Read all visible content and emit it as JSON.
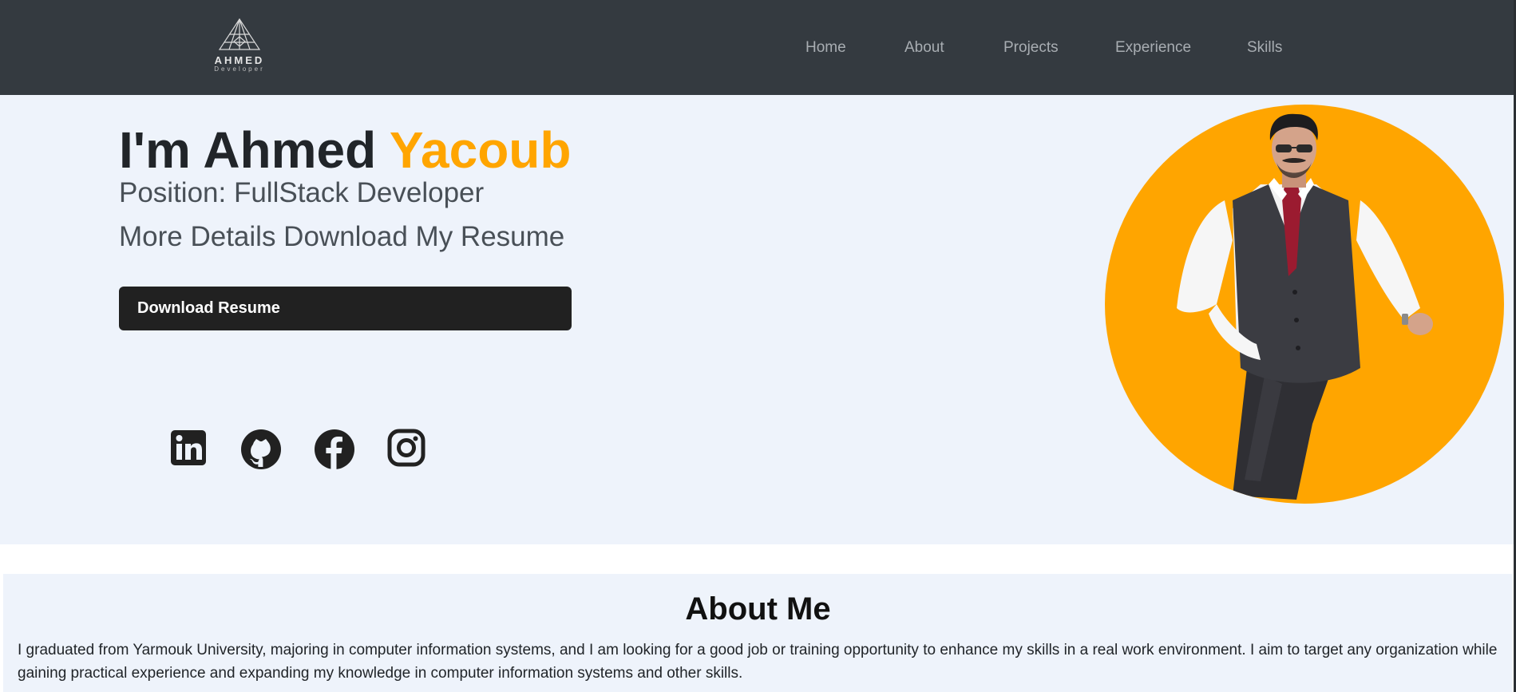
{
  "nav": {
    "brand_name": "AHMED",
    "brand_sub": "Developer",
    "items": [
      {
        "label": "Home"
      },
      {
        "label": "About"
      },
      {
        "label": "Projects"
      },
      {
        "label": "Experience"
      },
      {
        "label": "Skills"
      }
    ]
  },
  "hero": {
    "title_prefix": "I'm Ahmed ",
    "title_accent": "Yacoub",
    "position_line": "Position: FullStack Developer",
    "details_line": "More Details Download My Resume",
    "resume_button": "Download Resume",
    "socials": [
      {
        "icon": "linkedin-icon"
      },
      {
        "icon": "github-icon"
      },
      {
        "icon": "facebook-icon"
      },
      {
        "icon": "instagram-icon"
      }
    ],
    "avatar_background": "#ffa500"
  },
  "about": {
    "title": "About Me",
    "text": "I graduated from Yarmouk University, majoring in computer information systems, and I am looking for a good job or training opportunity to enhance my skills in a real work environment. I aim to target any organization while gaining practical experience and expanding my knowledge in computer information systems and other skills."
  },
  "colors": {
    "navbar": "#343a40",
    "accent": "#ffa500",
    "hero_background": "#eef3fb",
    "button": "#212121"
  }
}
